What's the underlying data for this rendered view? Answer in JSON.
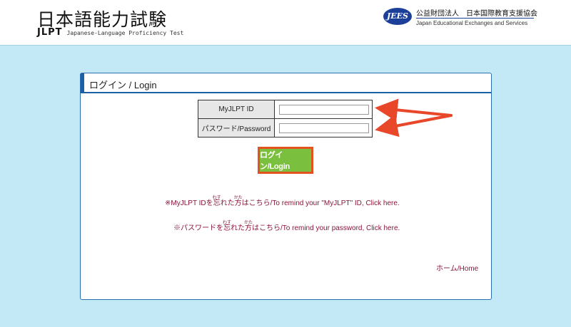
{
  "header": {
    "logo_title": "日本語能力試験",
    "logo_abbr": "JLPT",
    "logo_subtitle": "Japanese-Language Proficiency Test",
    "org_badge": "JEES",
    "org_name_jp": "公益財団法人　日本国際教育支援協会",
    "org_name_en": "Japan Educational Exchanges and Services"
  },
  "login": {
    "title": "ログイン / Login",
    "id_label": "MyJLPT ID",
    "password_label": "パスワード/Password",
    "id_value": "",
    "password_value": "",
    "button_label": "ログイン/Login"
  },
  "links": {
    "remind_id": {
      "prefix": "※MyJLPT IDを",
      "kanji1": "忘",
      "ruby1": "わす",
      "mid": "れた",
      "kanji2": "方",
      "ruby2": "かた",
      "suffix": "はこちら/To remind your \"MyJLPT\" ID, Click here."
    },
    "remind_password": {
      "prefix": "※パスワードを",
      "kanji1": "忘",
      "ruby1": "わす",
      "mid": "れた",
      "kanji2": "方",
      "ruby2": "かた",
      "suffix": "はこちら/To remind your password, Click here."
    },
    "home": "ホーム/Home"
  },
  "colors": {
    "page_background": "#c3e9f6",
    "panel_accent": "#1b5fa8",
    "button_fill": "#7bbf3e",
    "button_border": "#e25321",
    "link_color": "#8a1538",
    "annotation_arrow": "#e8472a"
  }
}
